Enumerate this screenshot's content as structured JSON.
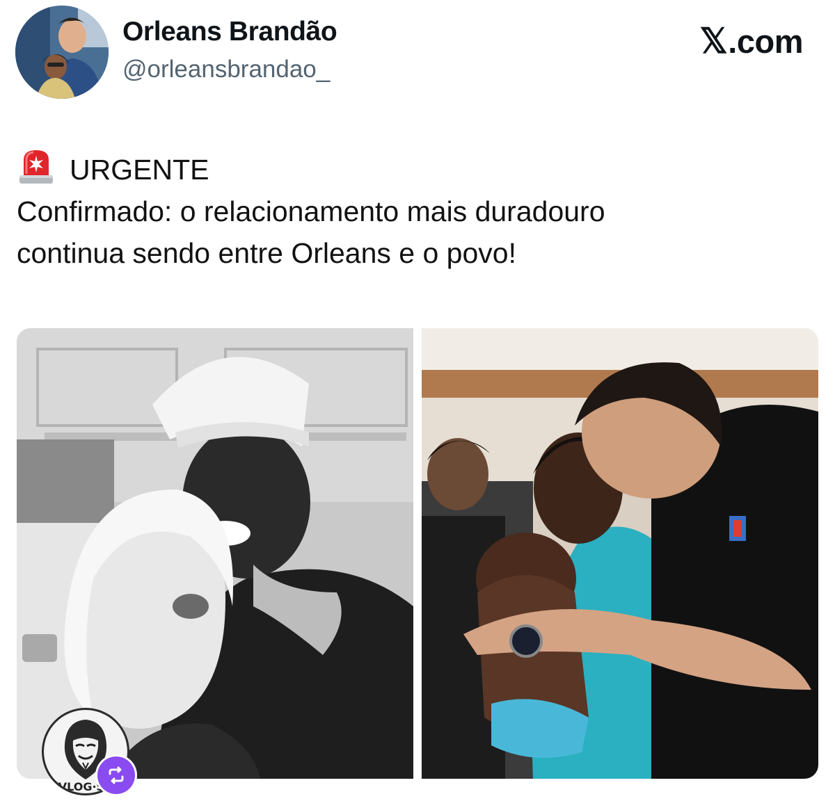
{
  "author": {
    "display_name": "Orleans Brandão",
    "handle": "@orleansbrandao_"
  },
  "header": {
    "site_label": ".com",
    "site_icon": "x-logo-icon"
  },
  "tweet": {
    "badge_icon": "rotating-light-emoji",
    "badge_label": "URGENTE",
    "text_lines": [
      "Confirmado: o relacionamento mais duradouro",
      "continua sendo entre Orleans e o povo!"
    ]
  },
  "media": {
    "watermark_text": "VLOG·SB",
    "repost_icon": "repost-icon"
  },
  "colors": {
    "text": "#0f1419",
    "secondary_text": "#536471",
    "repost_badge": "#8a4bf0",
    "siren_red": "#e0252b"
  }
}
